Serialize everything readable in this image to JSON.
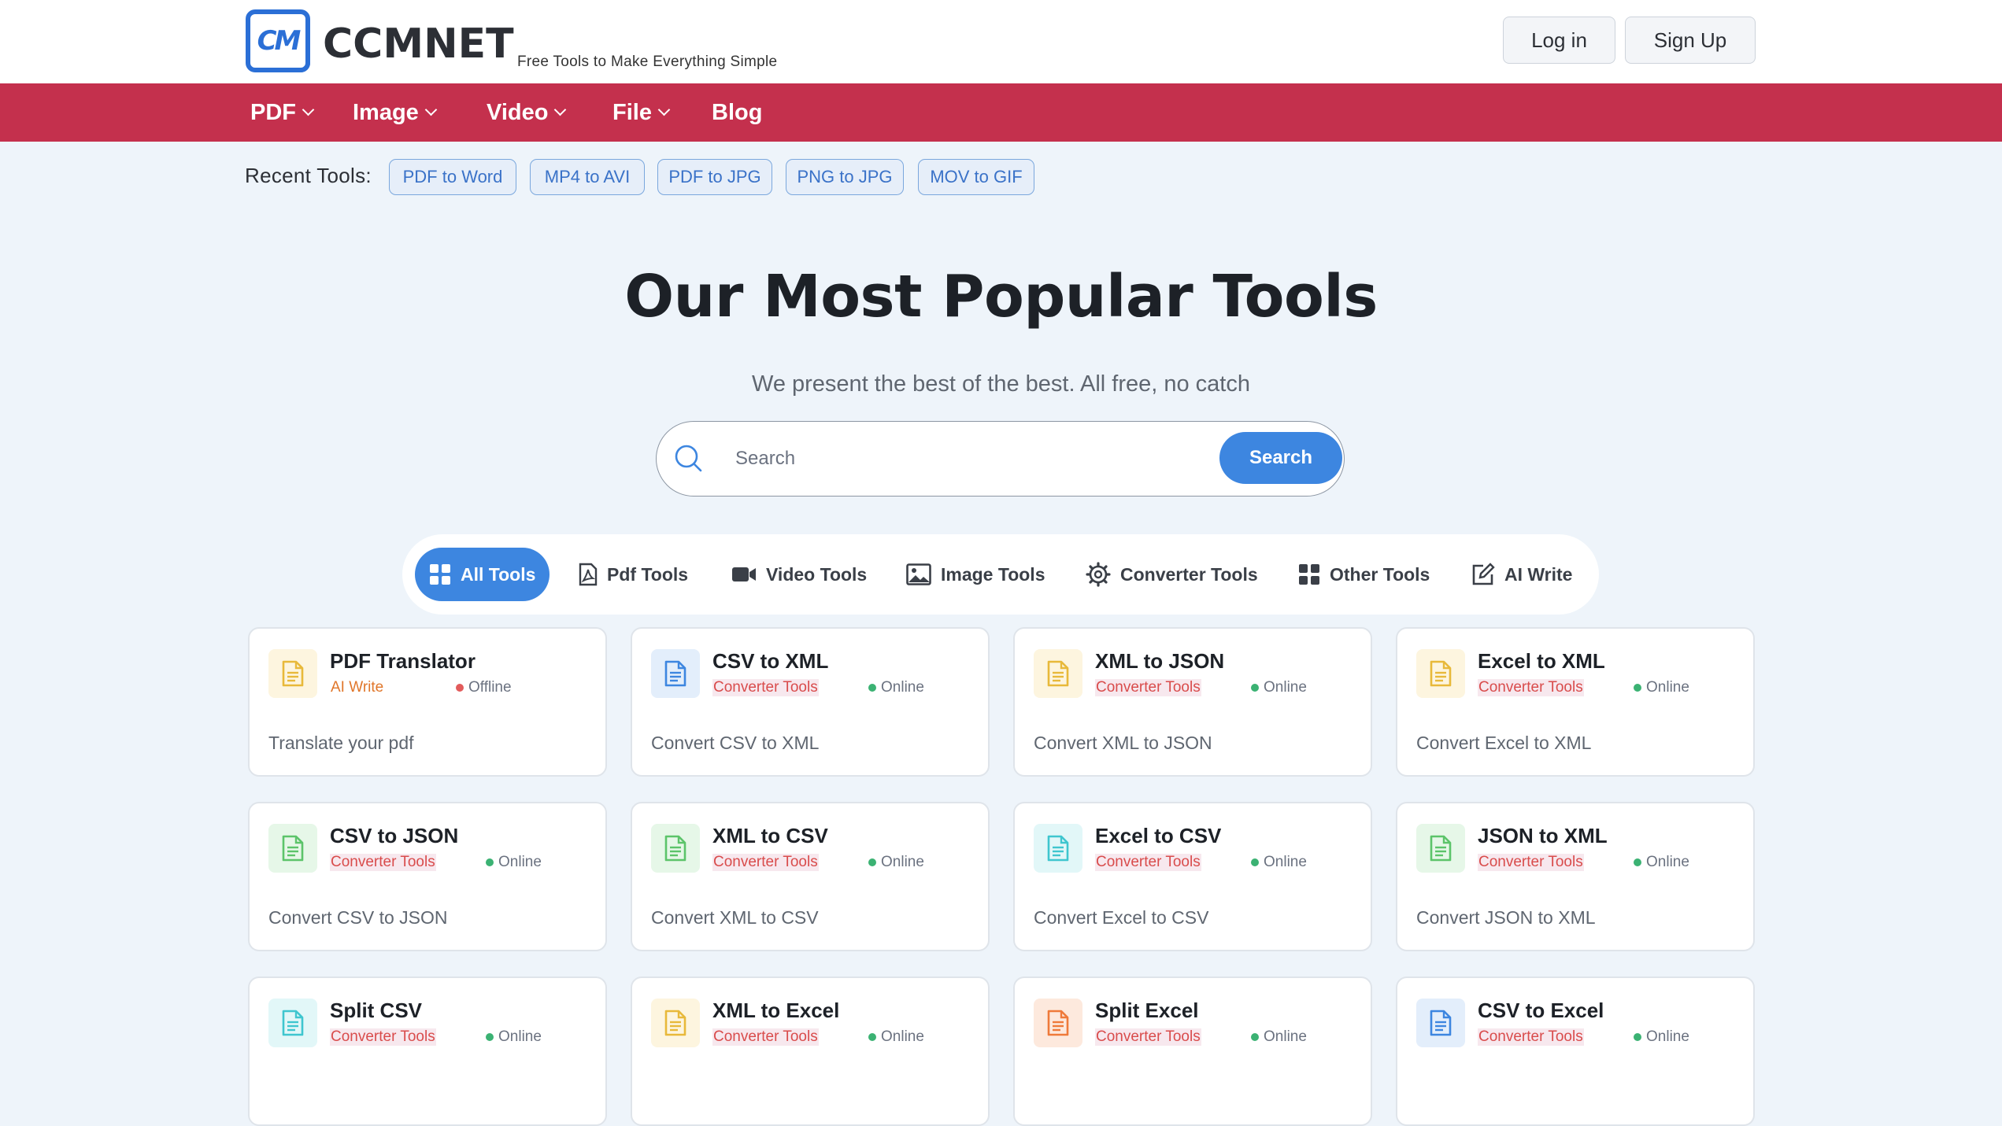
{
  "colors": {
    "brand_red": "#c4304d",
    "accent_blue": "#3d86e0",
    "page_bg": "#eef4fa",
    "online_green": "#3bb273",
    "offline_red": "#e25b5b"
  },
  "header": {
    "logo_mark": "CM",
    "logo_name": "CCMNET",
    "tagline": "Free Tools to Make Everything Simple",
    "login_label": "Log in",
    "signup_label": "Sign Up"
  },
  "nav": {
    "items": [
      {
        "label": "PDF",
        "has_dropdown": true
      },
      {
        "label": "Image",
        "has_dropdown": true
      },
      {
        "label": "Video",
        "has_dropdown": true
      },
      {
        "label": "File",
        "has_dropdown": true
      },
      {
        "label": "Blog",
        "has_dropdown": false
      }
    ]
  },
  "recent": {
    "label": "Recent Tools:",
    "chips": [
      "PDF to Word",
      "MP4 to AVI",
      "PDF to JPG",
      "PNG to JPG",
      "MOV to GIF"
    ]
  },
  "hero": {
    "title": "Our Most Popular Tools",
    "subtitle": "We present the best of the best. All free, no catch"
  },
  "search": {
    "placeholder": "Search",
    "value": "",
    "button_label": "Search",
    "icon": "search-icon"
  },
  "tabs": [
    {
      "label": "All Tools",
      "icon": "grid-icon",
      "active": true
    },
    {
      "label": "Pdf Tools",
      "icon": "pdf-icon",
      "active": false
    },
    {
      "label": "Video Tools",
      "icon": "video-camera-icon",
      "active": false
    },
    {
      "label": "Image Tools",
      "icon": "image-icon",
      "active": false
    },
    {
      "label": "Converter Tools",
      "icon": "gear-icon",
      "active": false
    },
    {
      "label": "Other Tools",
      "icon": "apps-icon",
      "active": false
    },
    {
      "label": "AI Write",
      "icon": "edit-icon",
      "active": false
    }
  ],
  "cards": [
    {
      "title": "PDF Translator",
      "category": "AI Write",
      "status": "Offline",
      "description": "Translate your pdf",
      "icon_color": "#e8b93a",
      "icon_bg": "#fdf5df"
    },
    {
      "title": "CSV to XML",
      "category": "Converter Tools",
      "status": "Online",
      "description": "Convert CSV to XML",
      "icon_color": "#3d86e0",
      "icon_bg": "#e3eefb"
    },
    {
      "title": "XML to JSON",
      "category": "Converter Tools",
      "status": "Online",
      "description": "Convert XML to JSON",
      "icon_color": "#e8b93a",
      "icon_bg": "#fdf5df"
    },
    {
      "title": "Excel to XML",
      "category": "Converter Tools",
      "status": "Online",
      "description": "Convert Excel to XML",
      "icon_color": "#e8b93a",
      "icon_bg": "#fdf5df"
    },
    {
      "title": "CSV to JSON",
      "category": "Converter Tools",
      "status": "Online",
      "description": "Convert CSV to JSON",
      "icon_color": "#5cc46a",
      "icon_bg": "#e6f7e8"
    },
    {
      "title": "XML to CSV",
      "category": "Converter Tools",
      "status": "Online",
      "description": "Convert XML to CSV",
      "icon_color": "#5cc46a",
      "icon_bg": "#e6f7e8"
    },
    {
      "title": "Excel to CSV",
      "category": "Converter Tools",
      "status": "Online",
      "description": "Convert Excel to CSV",
      "icon_color": "#3fc6cf",
      "icon_bg": "#e2f7f8"
    },
    {
      "title": "JSON to XML",
      "category": "Converter Tools",
      "status": "Online",
      "description": "Convert JSON to XML",
      "icon_color": "#5cc46a",
      "icon_bg": "#e6f7e8"
    },
    {
      "title": "Split CSV",
      "category": "Converter Tools",
      "status": "Online",
      "description": "",
      "icon_color": "#3fc6cf",
      "icon_bg": "#e2f7f8"
    },
    {
      "title": "XML to Excel",
      "category": "Converter Tools",
      "status": "Online",
      "description": "",
      "icon_color": "#e8b93a",
      "icon_bg": "#fdf5df"
    },
    {
      "title": "Split Excel",
      "category": "Converter Tools",
      "status": "Online",
      "description": "",
      "icon_color": "#ef7a3a",
      "icon_bg": "#fde9dd"
    },
    {
      "title": "CSV to Excel",
      "category": "Converter Tools",
      "status": "Online",
      "description": "",
      "icon_color": "#3d86e0",
      "icon_bg": "#e3eefb"
    }
  ]
}
